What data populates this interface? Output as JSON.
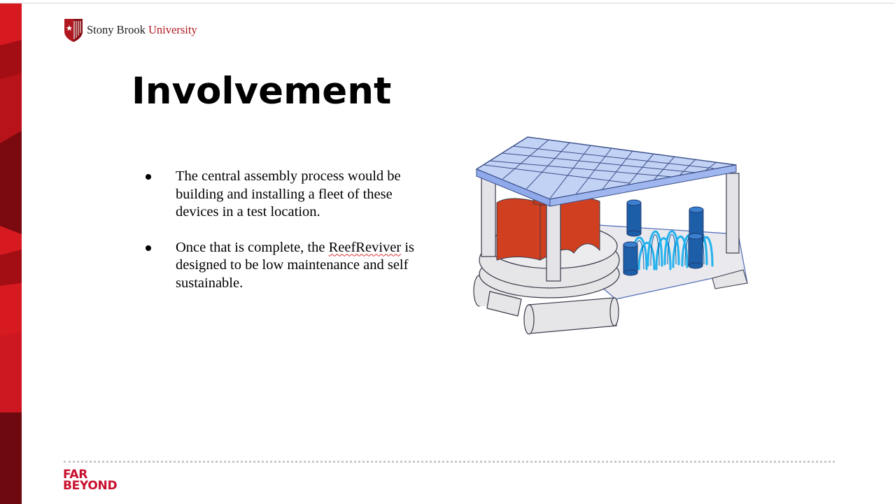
{
  "brand": {
    "name_part1": "Stony Brook ",
    "name_part2": "University",
    "tagline_line1": "FAR",
    "tagline_line2": "BEYOND",
    "primary_color": "#c8102e"
  },
  "slide": {
    "title": "Involvement",
    "bullets": [
      {
        "text": "The central assembly process would be building and installing a fleet of these devices in a test location."
      },
      {
        "text_before": "Once that is complete, the ",
        "flagged_word": "ReefReviver",
        "text_after": " is designed to be low maintenance and self sustainable."
      }
    ]
  },
  "illustration": {
    "icon": "reef-reviver-device-illustration"
  }
}
